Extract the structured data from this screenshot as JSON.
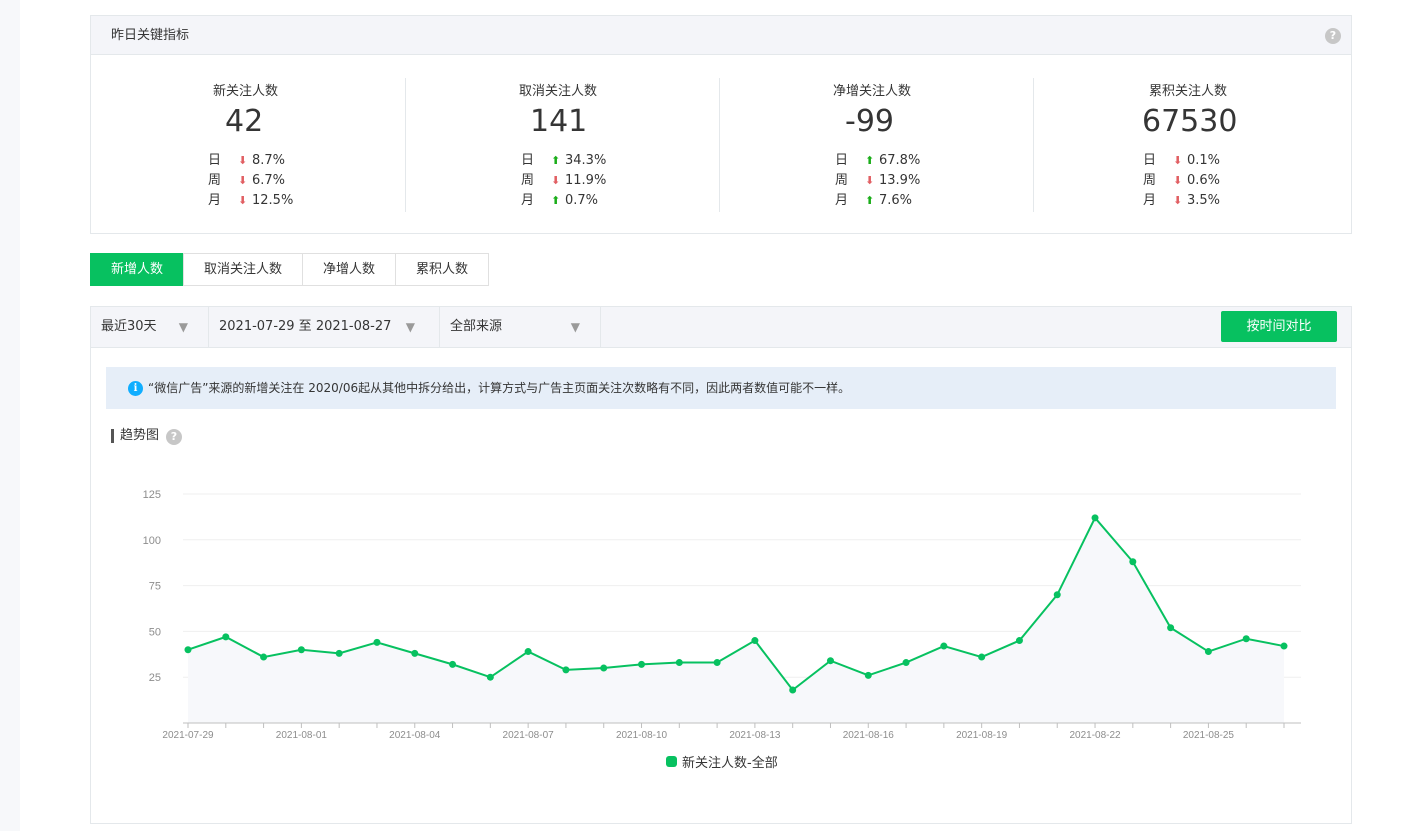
{
  "kpi": {
    "title": "昨日关键指标",
    "help": "?",
    "items": [
      {
        "label": "新关注人数",
        "value": "42",
        "cmp": [
          {
            "k": "日",
            "dir": "down",
            "v": "8.7%"
          },
          {
            "k": "周",
            "dir": "down",
            "v": "6.7%"
          },
          {
            "k": "月",
            "dir": "down",
            "v": "12.5%"
          }
        ]
      },
      {
        "label": "取消关注人数",
        "value": "141",
        "cmp": [
          {
            "k": "日",
            "dir": "up",
            "v": "34.3%"
          },
          {
            "k": "周",
            "dir": "down",
            "v": "11.9%"
          },
          {
            "k": "月",
            "dir": "up",
            "v": "0.7%"
          }
        ]
      },
      {
        "label": "净增关注人数",
        "value": "-99",
        "cmp": [
          {
            "k": "日",
            "dir": "up",
            "v": "67.8%"
          },
          {
            "k": "周",
            "dir": "down",
            "v": "13.9%"
          },
          {
            "k": "月",
            "dir": "up",
            "v": "7.6%"
          }
        ]
      },
      {
        "label": "累积关注人数",
        "value": "67530",
        "cmp": [
          {
            "k": "日",
            "dir": "down",
            "v": "0.1%"
          },
          {
            "k": "周",
            "dir": "down",
            "v": "0.6%"
          },
          {
            "k": "月",
            "dir": "down",
            "v": "3.5%"
          }
        ]
      }
    ]
  },
  "tabs": [
    "新增人数",
    "取消关注人数",
    "净增人数",
    "累积人数"
  ],
  "toolbar": {
    "range": "最近30天",
    "dates": "2021-07-29 至 2021-08-27",
    "source": "全部来源",
    "compare": "按时间对比"
  },
  "notice": "“微信广告”来源的新增关注在 2020/06起从其他中拆分给出，计算方式与广告主页面关注次数略有不同，因此两者数值可能不一样。",
  "section_title": "趋势图",
  "colors": {
    "accent": "#07c160",
    "up": "#1aad19",
    "down": "#e15f63"
  },
  "chart_data": {
    "type": "line",
    "x": [
      "2021-07-29",
      "2021-07-30",
      "2021-07-31",
      "2021-08-01",
      "2021-08-02",
      "2021-08-03",
      "2021-08-04",
      "2021-08-05",
      "2021-08-06",
      "2021-08-07",
      "2021-08-08",
      "2021-08-09",
      "2021-08-10",
      "2021-08-11",
      "2021-08-12",
      "2021-08-13",
      "2021-08-14",
      "2021-08-15",
      "2021-08-16",
      "2021-08-17",
      "2021-08-18",
      "2021-08-19",
      "2021-08-20",
      "2021-08-21",
      "2021-08-22",
      "2021-08-23",
      "2021-08-24",
      "2021-08-25",
      "2021-08-26",
      "2021-08-27"
    ],
    "series": [
      {
        "name": "新关注人数-全部",
        "values": [
          40,
          47,
          36,
          40,
          38,
          44,
          38,
          32,
          25,
          39,
          29,
          30,
          32,
          33,
          33,
          45,
          18,
          34,
          26,
          33,
          42,
          36,
          45,
          70,
          112,
          88,
          52,
          39,
          46,
          42
        ]
      }
    ],
    "xticks": [
      "2021-07-29",
      "2021-08-01",
      "2021-08-04",
      "2021-08-07",
      "2021-08-10",
      "2021-08-13",
      "2021-08-16",
      "2021-08-19",
      "2021-08-22",
      "2021-08-25"
    ],
    "yticks": [
      25,
      50,
      75,
      100,
      125
    ],
    "ylim": [
      0,
      125
    ],
    "grid": true,
    "legend": "bottom"
  }
}
